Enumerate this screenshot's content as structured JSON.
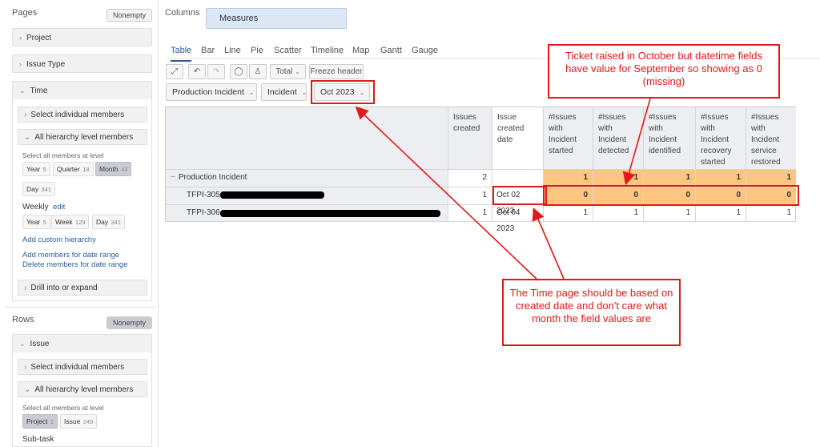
{
  "left": {
    "pages_label": "Pages",
    "pages_nonempty": "Nonempty",
    "project": "Project",
    "issue_type": "Issue Type",
    "time": "Time",
    "select_individual": "Select individual members",
    "all_hierarchy": "All hierarchy level members",
    "select_all_at_level": "Select all members at level",
    "levels": [
      {
        "label": "Year",
        "n": "5"
      },
      {
        "label": "Quarter",
        "n": "18"
      },
      {
        "label": "Month",
        "n": "43"
      },
      {
        "label": "Day",
        "n": "341"
      }
    ],
    "weekly": "Weekly",
    "weekly_edit": "edit",
    "weekly_levels": [
      {
        "label": "Year",
        "n": "5"
      },
      {
        "label": "Week",
        "n": "129"
      },
      {
        "label": "Day",
        "n": "341"
      }
    ],
    "add_custom": "Add custom hierarchy",
    "add_members_date": "Add members for date range",
    "delete_members_date": "Delete members for date range",
    "drill": "Drill into or expand",
    "rows_label": "Rows",
    "rows_nonempty": "Nonempty",
    "issue": "Issue",
    "rows_select_individual": "Select individual members",
    "rows_all_hierarchy": "All hierarchy level members",
    "rows_select_all": "Select all members at level",
    "rows_levels": [
      {
        "label": "Project",
        "n": "1"
      },
      {
        "label": "Issue",
        "n": "249"
      }
    ],
    "subtask": "Sub-task"
  },
  "columns": {
    "label": "Columns",
    "measures": "Measures"
  },
  "tabs": [
    "Table",
    "Bar",
    "Line",
    "Pie",
    "Scatter",
    "Timeline",
    "Map",
    "Gantt",
    "Gauge"
  ],
  "toolbar": {
    "total": "Total",
    "freeze": "Freeze header"
  },
  "filters": [
    "Production Incident",
    "Incident",
    "Oct 2023"
  ],
  "table": {
    "headers": [
      "Issues created",
      "Issue created date",
      "#Issues with Incident started",
      "#Issues with Incident detected",
      "#Issues with Incident identified",
      "#Issues with Incident recovery started",
      "#Issues with Incident service restored"
    ],
    "group": {
      "label": "Production Incident",
      "values": [
        "2",
        "",
        "1",
        "1",
        "1",
        "1",
        "1"
      ]
    },
    "rows": [
      {
        "key": "TFPI-305",
        "values": [
          "1",
          "Oct 02 2023",
          "0",
          "0",
          "0",
          "0",
          "0"
        ]
      },
      {
        "key": "TFPI-306",
        "values": [
          "1",
          "Oct 04 2023",
          "1",
          "1",
          "1",
          "1",
          "1"
        ]
      }
    ]
  },
  "annotations": {
    "top": "Ticket raised in October but datetime fields have value for September so showing as 0 (missing)",
    "bottom": "The Time page should be based on created date and don't care what month the field values are"
  },
  "colors": {
    "accent": "#2a5d9f",
    "highlight": "#fcc680",
    "annotation": "#e01a1a"
  }
}
